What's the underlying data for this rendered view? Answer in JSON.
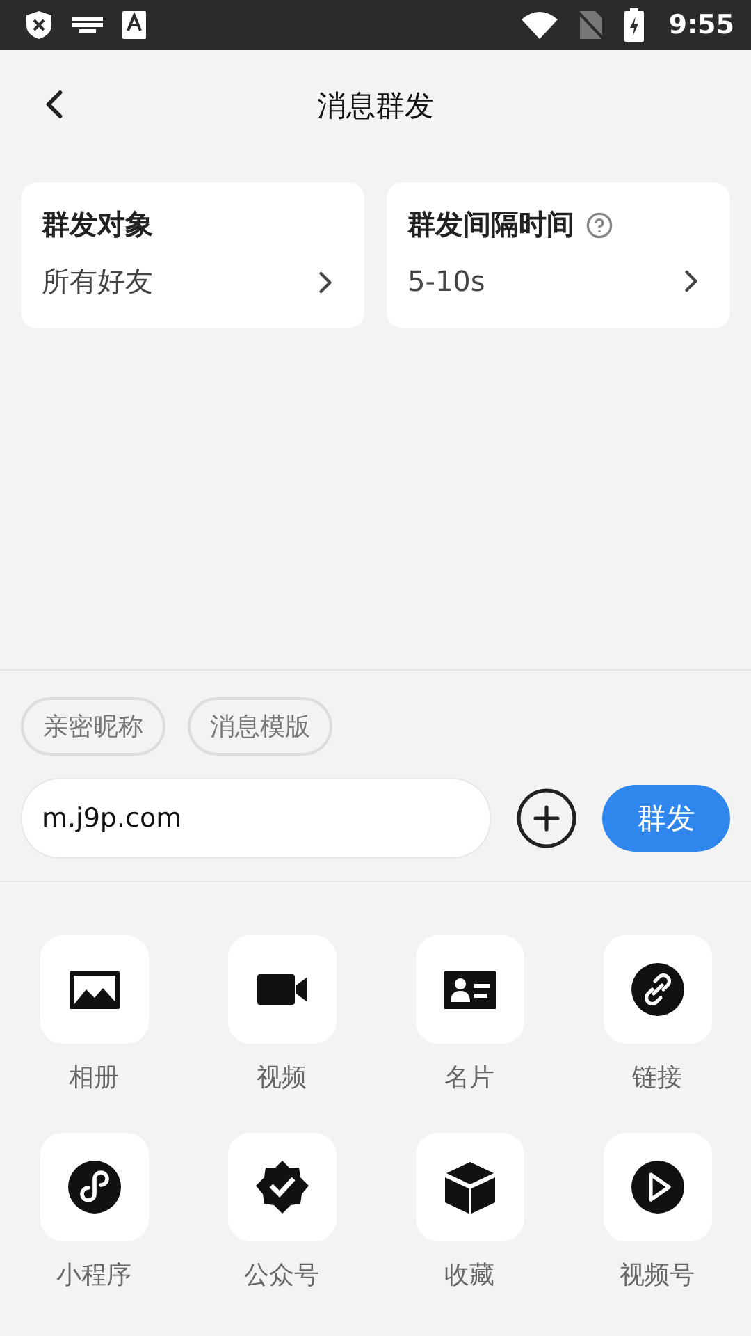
{
  "status_bar": {
    "time": "9:55"
  },
  "header": {
    "title": "消息群发"
  },
  "settings": [
    {
      "label": "群发对象",
      "value": "所有好友",
      "help": false
    },
    {
      "label": "群发间隔时间",
      "value": "5-10s",
      "help": true
    }
  ],
  "chips": [
    "亲密昵称",
    "消息模版"
  ],
  "composer": {
    "value": "m.j9p.com",
    "send": "群发"
  },
  "actions": [
    {
      "kind": "album",
      "label": "相册"
    },
    {
      "kind": "video",
      "label": "视频"
    },
    {
      "kind": "card",
      "label": "名片"
    },
    {
      "kind": "link",
      "label": "链接"
    },
    {
      "kind": "miniapp",
      "label": "小程序"
    },
    {
      "kind": "verified",
      "label": "公众号"
    },
    {
      "kind": "box",
      "label": "收藏"
    },
    {
      "kind": "play",
      "label": "视频号"
    }
  ]
}
